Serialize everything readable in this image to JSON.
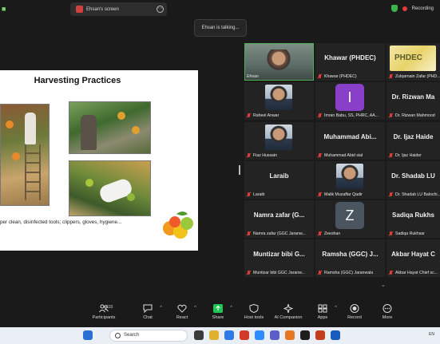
{
  "topbar": {
    "share_label": "Ehsan's screen",
    "recording_label": "Recording"
  },
  "talking": "Ehsan is talking...",
  "slide": {
    "title": "Harvesting Practices",
    "caption": "per clean, disinfected tools; clippers, gloves, hygiene..."
  },
  "participants": [
    {
      "display": "",
      "label": "Ehsan",
      "type": "video"
    },
    {
      "display": "Khawar (PHDEC)",
      "label": "Khawar (PHDEC)",
      "type": "name"
    },
    {
      "display": "",
      "label": "Zulqarnain Zafar (PHD...",
      "type": "logo"
    },
    {
      "display": "",
      "label": "Raheel Anwar",
      "type": "photo"
    },
    {
      "display": "I",
      "label": "Imran Babu, SS, PHRC, AA...",
      "type": "letter",
      "color": "#8a3fc8"
    },
    {
      "display": "Dr. Rizwan Ma",
      "label": "Dr. Rizwan Mahmood",
      "type": "name"
    },
    {
      "display": "",
      "label": "Fiaz Hussain",
      "type": "photo"
    },
    {
      "display": "Muhammad Abi...",
      "label": "Muhammad Abid sial",
      "type": "name"
    },
    {
      "display": "Dr. Ijaz Haide",
      "label": "Dr. Ijaz Haider",
      "type": "name"
    },
    {
      "display": "Laraib",
      "label": "Laraib",
      "type": "name"
    },
    {
      "display": "",
      "label": "Malik Muzaffar Qadir",
      "type": "photo"
    },
    {
      "display": "Dr. Shadab LU",
      "label": "Dr. Shadab LU Balochi...",
      "type": "name"
    },
    {
      "display": "Namra zafar (G...",
      "label": "Namra zafar (GGC Jaranw...",
      "type": "name"
    },
    {
      "display": "Z",
      "label": "Zeeshan",
      "type": "letter",
      "color": "#4a5560"
    },
    {
      "display": "Sadiqa Rukhs",
      "label": "Sadiqa Rukhsar",
      "type": "name"
    },
    {
      "display": "Muntizar bibi G...",
      "label": "Muntizar bibi GGC Jaranw...",
      "type": "name"
    },
    {
      "display": "Ramsha (GGC) J...",
      "label": "Ramsha (GGC) Jaranwala",
      "type": "name"
    },
    {
      "display": "Akbar Hayat C",
      "label": "Akbar Hayat Chief sc...",
      "type": "name"
    }
  ],
  "toolbar": {
    "participants": "Participants",
    "participants_count": "103",
    "chat": "Chat",
    "react": "React",
    "share": "Share",
    "host_tools": "Host tools",
    "ai_companion": "AI Companion",
    "apps": "Apps",
    "record": "Record",
    "more": "More"
  },
  "taskbar": {
    "search_placeholder": "Search",
    "tray": "EN"
  },
  "colors": {
    "share_green": "#1ec653",
    "recording_red": "#e03b3b",
    "active_speaker": "#4caf50"
  }
}
